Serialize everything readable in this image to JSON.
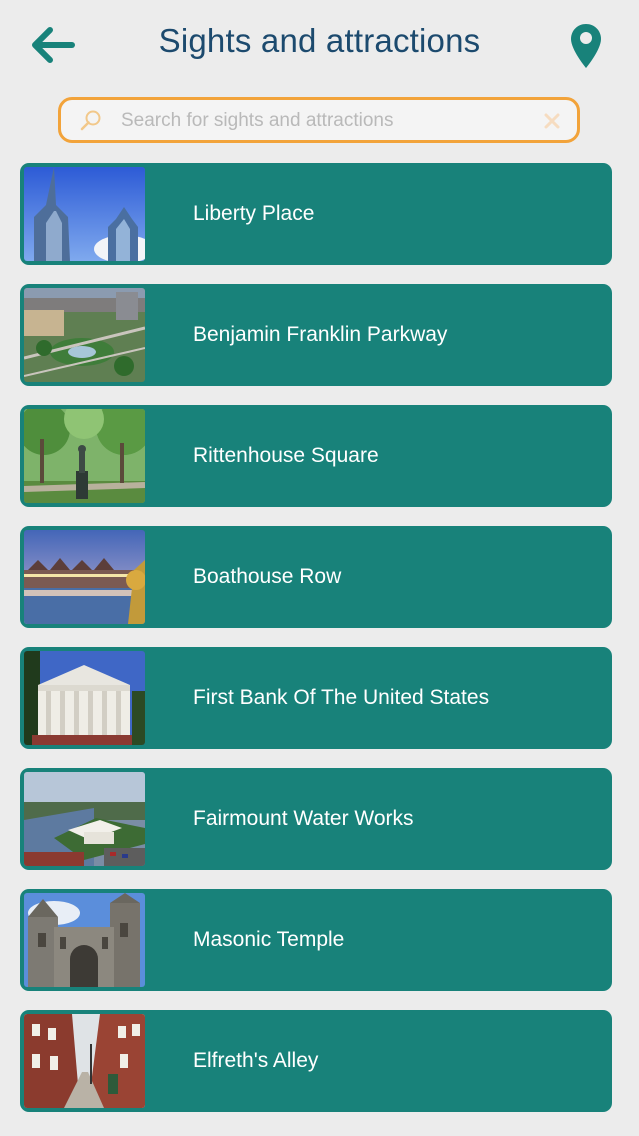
{
  "colors": {
    "accent": "#18827a",
    "title": "#1c4a6e",
    "search_border": "#f2a33a",
    "background": "#ececec"
  },
  "header": {
    "title": "Sights and attractions",
    "back_icon": "arrow-left-icon",
    "map_icon": "map-pin-icon"
  },
  "search": {
    "placeholder": "Search for sights and attractions",
    "value": "",
    "icon": "search-icon",
    "clear_icon": "clear-icon"
  },
  "attractions": [
    {
      "name": "Liberty Place",
      "thumbnail": "skyscraper-photo"
    },
    {
      "name": "Benjamin Franklin Parkway",
      "thumbnail": "parkway-aerial-photo"
    },
    {
      "name": "Rittenhouse Square",
      "thumbnail": "park-statue-photo"
    },
    {
      "name": "Boathouse Row",
      "thumbnail": "boathouses-photo"
    },
    {
      "name": "First Bank Of The United States",
      "thumbnail": "columned-bank-photo"
    },
    {
      "name": "Fairmount Water Works",
      "thumbnail": "waterworks-photo"
    },
    {
      "name": "Masonic Temple",
      "thumbnail": "temple-photo"
    },
    {
      "name": "Elfreth's Alley",
      "thumbnail": "alley-photo"
    }
  ]
}
